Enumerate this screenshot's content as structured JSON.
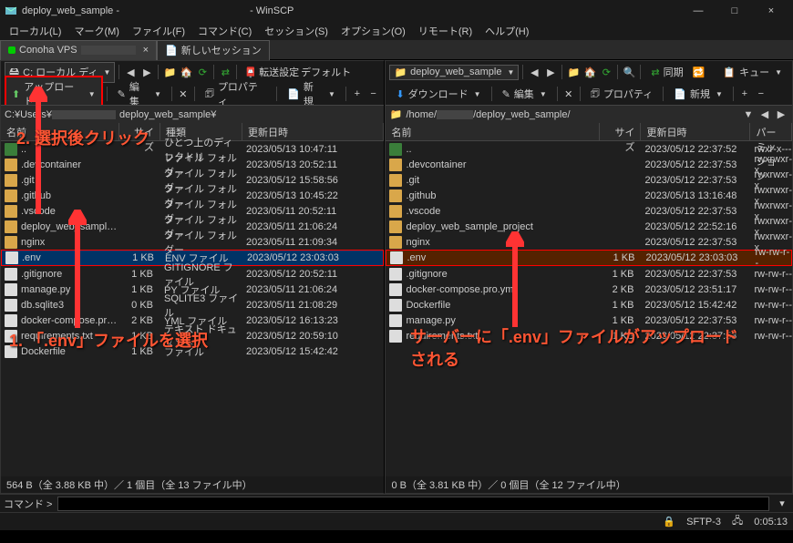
{
  "window": {
    "title_left": "deploy_web_sample -",
    "title_right": "- WinSCP",
    "minimize": "—",
    "maximize": "□",
    "close": "×"
  },
  "menu": {
    "local": "ローカル(L)",
    "mark": "マーク(M)",
    "file": "ファイル(F)",
    "command": "コマンド(C)",
    "session": "セッション(S)",
    "option": "オプション(O)",
    "remote": "リモート(R)",
    "help": "ヘルプ(H)"
  },
  "tabs": {
    "session_name": "Conoha VPS",
    "new_session": "新しいセッション"
  },
  "toolbar": {
    "transfer_label": "転送設定",
    "transfer_value": "デフォルト",
    "queue": "キュー"
  },
  "local": {
    "drive": "C: ローカル ディ",
    "upload": "アップロード",
    "edit": "編集",
    "property": "プロパティ",
    "new": "新規",
    "path_prefix": "C:¥Users¥",
    "path_suffix": "deploy_web_sample¥",
    "cols": {
      "name": "名前",
      "size": "サイズ",
      "type": "種類",
      "date": "更新日時"
    },
    "rows": [
      {
        "icon": "folder-up",
        "name": "..",
        "size": "",
        "type": "ひとつ上のディレクトリ",
        "date": "2023/05/13 10:47:11"
      },
      {
        "icon": "folder",
        "name": ".devcontainer",
        "size": "",
        "type": "ファイル フォルダー",
        "date": "2023/05/13 20:52:11"
      },
      {
        "icon": "folder",
        "name": ".git",
        "size": "",
        "type": "ファイル フォルダー",
        "date": "2023/05/12 15:58:56"
      },
      {
        "icon": "folder",
        "name": ".github",
        "size": "",
        "type": "ファイル フォルダー",
        "date": "2023/05/13 10:45:22"
      },
      {
        "icon": "folder",
        "name": ".vscode",
        "size": "",
        "type": "ファイル フォルダー",
        "date": "2023/05/11 20:52:11"
      },
      {
        "icon": "folder",
        "name": "deploy_web_sample_...",
        "size": "",
        "type": "ファイル フォルダー",
        "date": "2023/05/11 21:06:24"
      },
      {
        "icon": "folder",
        "name": "nginx",
        "size": "",
        "type": "ファイル フォルダー",
        "date": "2023/05/11 21:09:34"
      },
      {
        "icon": "file",
        "name": ".env",
        "size": "1 KB",
        "type": "ENV ファイル",
        "date": "2023/05/12 23:03:03",
        "selected": true
      },
      {
        "icon": "file",
        "name": ".gitignore",
        "size": "1 KB",
        "type": "GITIGNORE ファイル",
        "date": "2023/05/12 20:52:11"
      },
      {
        "icon": "file",
        "name": "manage.py",
        "size": "1 KB",
        "type": "PY ファイル",
        "date": "2023/05/11 21:06:24"
      },
      {
        "icon": "file",
        "name": "db.sqlite3",
        "size": "0 KB",
        "type": "SQLITE3 ファイル",
        "date": "2023/05/11 21:08:29"
      },
      {
        "icon": "file",
        "name": "docker-compose.pro...",
        "size": "2 KB",
        "type": "YML ファイル",
        "date": "2023/05/12 16:13:23"
      },
      {
        "icon": "file",
        "name": "requirements.txt",
        "size": "1 KB",
        "type": "テキスト ドキュメント",
        "date": "2023/05/12 20:59:10"
      },
      {
        "icon": "file",
        "name": "Dockerfile",
        "size": "1 KB",
        "type": "ファイル",
        "date": "2023/05/12 15:42:42"
      }
    ],
    "status": "564 B（全 3.88 KB 中）／ 1 個目（全 13 ファイル中）"
  },
  "remote": {
    "folder": "deploy_web_sample",
    "download": "ダウンロード",
    "edit": "編集",
    "property": "プロパティ",
    "new": "新規",
    "sync": "同期",
    "path_prefix": "/home/",
    "path_suffix": "/deploy_web_sample/",
    "cols": {
      "name": "名前",
      "size": "サイズ",
      "date": "更新日時",
      "perm": "パーミッション"
    },
    "rows": [
      {
        "icon": "folder-up",
        "name": "..",
        "size": "",
        "date": "2023/05/12 22:37:52",
        "perm": "rwxr-x---"
      },
      {
        "icon": "folder",
        "name": ".devcontainer",
        "size": "",
        "date": "2023/05/12 22:37:53",
        "perm": "rwxrwxr-x"
      },
      {
        "icon": "folder",
        "name": ".git",
        "size": "",
        "date": "2023/05/12 22:37:53",
        "perm": "rwxrwxr-x"
      },
      {
        "icon": "folder",
        "name": ".github",
        "size": "",
        "date": "2023/05/13 13:16:48",
        "perm": "rwxrwxr-x"
      },
      {
        "icon": "folder",
        "name": ".vscode",
        "size": "",
        "date": "2023/05/12 22:37:53",
        "perm": "rwxrwxr-x"
      },
      {
        "icon": "folder",
        "name": "deploy_web_sample_project",
        "size": "",
        "date": "2023/05/12 22:52:16",
        "perm": "rwxrwxr-x"
      },
      {
        "icon": "folder",
        "name": "nginx",
        "size": "",
        "date": "2023/05/12 22:37:53",
        "perm": "rwxrwxr-x"
      },
      {
        "icon": "file",
        "name": ".env",
        "size": "1 KB",
        "date": "2023/05/12 23:03:03",
        "perm": "rw-rw-r--",
        "highlight": true
      },
      {
        "icon": "file",
        "name": ".gitignore",
        "size": "1 KB",
        "date": "2023/05/12 22:37:53",
        "perm": "rw-rw-r--"
      },
      {
        "icon": "file",
        "name": "docker-compose.pro.yml",
        "size": "2 KB",
        "date": "2023/05/12 23:51:17",
        "perm": "rw-rw-r--"
      },
      {
        "icon": "file",
        "name": "Dockerfile",
        "size": "1 KB",
        "date": "2023/05/12 15:42:42",
        "perm": "rw-rw-r--"
      },
      {
        "icon": "file",
        "name": "manage.py",
        "size": "1 KB",
        "date": "2023/05/12 22:37:53",
        "perm": "rw-rw-r--"
      },
      {
        "icon": "file",
        "name": "requirements.txt",
        "size": "1 KB",
        "date": "2023/05/12 22:37:53",
        "perm": "rw-rw-r--"
      }
    ],
    "status": "0 B（全 3.81 KB 中）／ 0 個目（全 12 ファイル中）"
  },
  "annotations": {
    "step2": "2. 選択後クリック",
    "step1": "1. 「.env」ファイルを選択",
    "server": "サーバーに「.env」ファイルがアップロードされる"
  },
  "command": {
    "label": "コマンド >"
  },
  "footer": {
    "proto": "SFTP-3",
    "time": "0:05:13"
  }
}
